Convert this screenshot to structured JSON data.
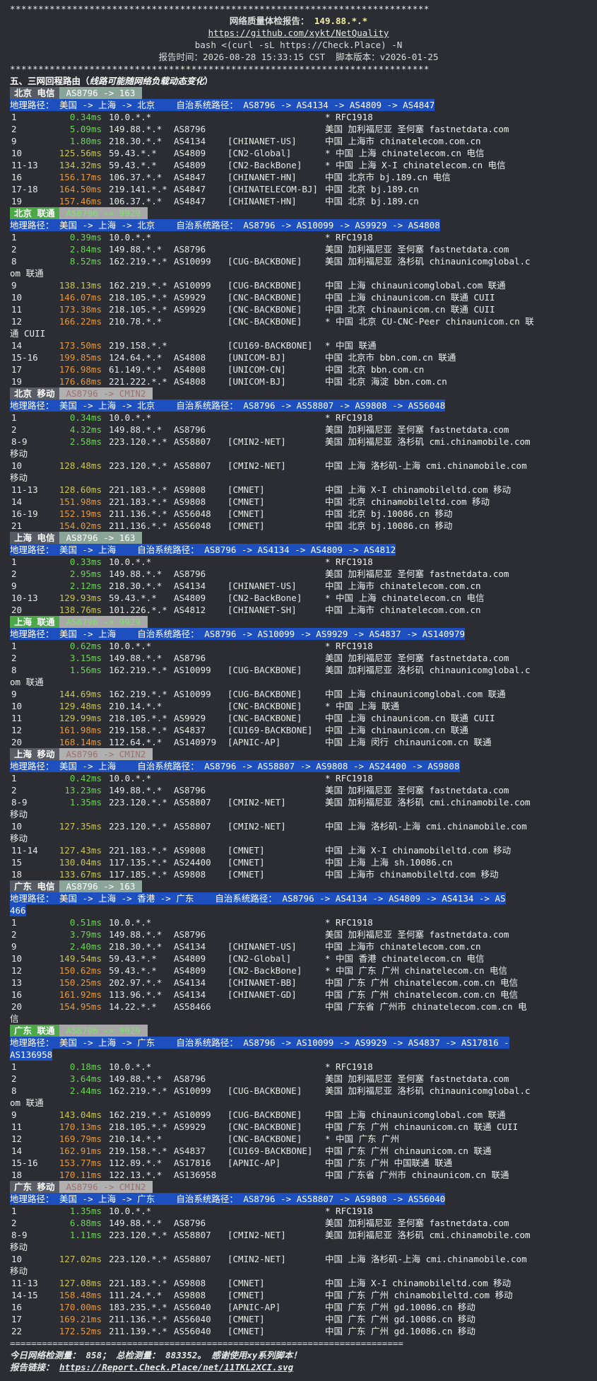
{
  "stars": "**************************************************************************",
  "header": {
    "title": "网络质量体检报告：",
    "ip": "149.88.*.*",
    "url": "https://github.com/xykt/NetQuality",
    "cmd": "bash <(curl -sL https://Check.Place) -N",
    "time_label": "报告时间：",
    "time": "2026-08-28 15:33:15 CST",
    "ver_label": "脚本版本：",
    "ver": "v2026-01-25"
  },
  "section": {
    "title": "五、三网回程路由（",
    "subtitle": "线路可能随网络负载动态变化",
    "close": "）"
  },
  "blocks": [
    {
      "city": "北京 电信",
      "city_class": "city-ct",
      "asg": "AS8796 -> 163",
      "asg_class": "g",
      "route": "地理路径： 美国 -> 上海 -> 北京    自治系统路径： AS8796 -> AS4134 -> AS4809 -> AS4847",
      "hops": [
        {
          "n": "1",
          "ms": "0.34ms",
          "c": "g",
          "ip": "10.0.*.*",
          "as": "",
          "tag": "",
          "geo": "* RFC1918"
        },
        {
          "n": "2",
          "ms": "5.09ms",
          "c": "g",
          "ip": "149.88.*.*",
          "as": "AS8796",
          "tag": "",
          "geo": "美国 加利福尼亚 圣何塞 fastnetdata.com"
        },
        {
          "n": "9",
          "ms": "1.80ms",
          "c": "g",
          "ip": "218.30.*.*",
          "as": "AS4134",
          "tag": "[CHINANET-US]",
          "geo": "中国 上海市 chinatelecom.com.cn"
        },
        {
          "n": "10",
          "ms": "125.56ms",
          "c": "y",
          "ip": "59.43.*.*",
          "as": "AS4809",
          "tag": "[CN2-Global]",
          "geo": "* 中国 上海 chinatelecom.cn 电信"
        },
        {
          "n": "11-13",
          "ms": "134.32ms",
          "c": "y",
          "ip": "59.43.*.*",
          "as": "AS4809",
          "tag": "[CN2-BackBone]",
          "geo": "* 中国 上海 X-I chinatelecom.cn 电信"
        },
        {
          "n": "16",
          "ms": "156.17ms",
          "c": "o",
          "ip": "106.37.*.*",
          "as": "AS4847",
          "tag": "[CHINANET-HN]",
          "geo": "中国 北京市 bj.189.cn 电信"
        },
        {
          "n": "17-18",
          "ms": "164.50ms",
          "c": "o",
          "ip": "219.141.*.*",
          "as": "AS4847",
          "tag": "[CHINATELECOM-BJ]",
          "geo": "中国 北京 bj.189.cn"
        },
        {
          "n": "19",
          "ms": "157.46ms",
          "c": "o",
          "ip": "106.37.*.*",
          "as": "AS4847",
          "tag": "[CHINANET-HN]",
          "geo": "中国 北京 bj.189.cn"
        }
      ]
    },
    {
      "city": "北京 联通",
      "city_class": "city-cu",
      "asg": "AS8796 -> 9929",
      "asg_class": "y",
      "route": "地理路径： 美国 -> 上海 -> 北京    自治系统路径： AS8796 -> AS10099 -> AS9929 -> AS4808",
      "hops": [
        {
          "n": "1",
          "ms": "0.39ms",
          "c": "g",
          "ip": "10.0.*.*",
          "as": "",
          "tag": "",
          "geo": "* RFC1918"
        },
        {
          "n": "2",
          "ms": "2.84ms",
          "c": "g",
          "ip": "149.88.*.*",
          "as": "AS8796",
          "tag": "",
          "geo": "美国 加利福尼亚 圣何塞 fastnetdata.com"
        },
        {
          "n": "8",
          "ms": "8.52ms",
          "c": "g",
          "ip": "162.219.*.*",
          "as": "AS10099",
          "tag": "[CUG-BACKBONE]",
          "geo": "美国 加利福尼亚 洛杉矶 chinaunicomglobal.c",
          "cont": "om 联通"
        },
        {
          "n": "9",
          "ms": "138.13ms",
          "c": "y",
          "ip": "162.219.*.*",
          "as": "AS10099",
          "tag": "[CUG-BACKBONE]",
          "geo": "中国 上海 chinaunicomglobal.com 联通"
        },
        {
          "n": "10",
          "ms": "146.07ms",
          "c": "o",
          "ip": "218.105.*.*",
          "as": "AS9929",
          "tag": "[CNC-BACKBONE]",
          "geo": "中国 上海 chinaunicom.cn 联通 CUII"
        },
        {
          "n": "11",
          "ms": "173.38ms",
          "c": "o",
          "ip": "218.105.*.*",
          "as": "AS9929",
          "tag": "[CNC-BACKBONE]",
          "geo": "中国 北京 chinaunicom.cn 联通 CUII"
        },
        {
          "n": "12",
          "ms": "166.22ms",
          "c": "o",
          "ip": "210.78.*.*",
          "as": "",
          "tag": "[CNC-BACKBONE]",
          "geo": "* 中国 北京 CU-CNC-Peer chinaunicom.cn 联",
          "cont": "通 CUII"
        },
        {
          "n": "14",
          "ms": "173.50ms",
          "c": "o",
          "ip": "219.158.*.*",
          "as": "",
          "tag": "[CU169-BACKBONE]",
          "geo": "* 中国 联通"
        },
        {
          "n": "15-16",
          "ms": "199.85ms",
          "c": "o",
          "ip": "124.64.*.*",
          "as": "AS4808",
          "tag": "[UNICOM-BJ]",
          "geo": "中国 北京市 bbn.com.cn 联通"
        },
        {
          "n": "17",
          "ms": "176.98ms",
          "c": "o",
          "ip": "61.149.*.*",
          "as": "AS4808",
          "tag": "[UNICOM-CN]",
          "geo": "中国 北京 bbn.com.cn"
        },
        {
          "n": "19",
          "ms": "176.68ms",
          "c": "o",
          "ip": "221.222.*.*",
          "as": "AS4808",
          "tag": "[UNICOM-BJ]",
          "geo": "中国 北京 海淀 bbn.com.cn"
        }
      ]
    },
    {
      "city": "北京 移动",
      "city_class": "city-cm",
      "asg": "AS8796 -> CMIN2",
      "asg_class": "c",
      "route": "地理路径： 美国 -> 上海 -> 北京    自治系统路径： AS8796 -> AS58807 -> AS9808 -> AS56048",
      "hops": [
        {
          "n": "1",
          "ms": "0.34ms",
          "c": "g",
          "ip": "10.0.*.*",
          "as": "",
          "tag": "",
          "geo": "* RFC1918"
        },
        {
          "n": "2",
          "ms": "4.32ms",
          "c": "g",
          "ip": "149.88.*.*",
          "as": "AS8796",
          "tag": "",
          "geo": "美国 加利福尼亚 圣何塞 fastnetdata.com"
        },
        {
          "n": "8-9",
          "ms": "2.58ms",
          "c": "g",
          "ip": "223.120.*.*",
          "as": "AS58807",
          "tag": "[CMIN2-NET]",
          "geo": "美国 加利福尼亚 洛杉矶 cmi.chinamobile.com",
          "cont": "移动"
        },
        {
          "n": "10",
          "ms": "128.48ms",
          "c": "y",
          "ip": "223.120.*.*",
          "as": "AS58807",
          "tag": "[CMIN2-NET]",
          "geo": "中国 上海 洛杉矶-上海 cmi.chinamobile.com",
          "cont": "移动"
        },
        {
          "n": "11-13",
          "ms": "128.60ms",
          "c": "y",
          "ip": "221.183.*.*",
          "as": "AS9808",
          "tag": "[CMNET]",
          "geo": "中国 上海 X-I chinamobileltd.com 移动"
        },
        {
          "n": "14",
          "ms": "151.98ms",
          "c": "o",
          "ip": "221.183.*.*",
          "as": "AS9808",
          "tag": "[CMNET]",
          "geo": "中国 北京 chinamobileltd.com 移动"
        },
        {
          "n": "16-19",
          "ms": "152.19ms",
          "c": "o",
          "ip": "211.136.*.*",
          "as": "AS56048",
          "tag": "[CMNET]",
          "geo": "中国 北京 bj.10086.cn 移动"
        },
        {
          "n": "21",
          "ms": "154.02ms",
          "c": "o",
          "ip": "211.136.*.*",
          "as": "AS56048",
          "tag": "[CMNET]",
          "geo": "中国 北京 bj.10086.cn 移动"
        }
      ]
    },
    {
      "city": "上海 电信",
      "city_class": "city-ct",
      "asg": "AS8796 -> 163",
      "asg_class": "g",
      "route": "地理路径： 美国 -> 上海    自治系统路径： AS8796 -> AS4134 -> AS4809 -> AS4812",
      "hops": [
        {
          "n": "1",
          "ms": "0.33ms",
          "c": "g",
          "ip": "10.0.*.*",
          "as": "",
          "tag": "",
          "geo": "* RFC1918"
        },
        {
          "n": "2",
          "ms": "2.95ms",
          "c": "g",
          "ip": "149.88.*.*",
          "as": "AS8796",
          "tag": "",
          "geo": "美国 加利福尼亚 圣何塞 fastnetdata.com"
        },
        {
          "n": "9",
          "ms": "2.12ms",
          "c": "g",
          "ip": "218.30.*.*",
          "as": "AS4134",
          "tag": "[CHINANET-US]",
          "geo": "中国 上海市 chinatelecom.com.cn"
        },
        {
          "n": "10-13",
          "ms": "129.93ms",
          "c": "y",
          "ip": "59.43.*.*",
          "as": "AS4809",
          "tag": "[CN2-BackBone]",
          "geo": "* 中国 上海 chinatelecom.cn 电信"
        },
        {
          "n": "20",
          "ms": "138.76ms",
          "c": "y",
          "ip": "101.226.*.*",
          "as": "AS4812",
          "tag": "[CHINANET-SH]",
          "geo": "中国 上海市 chinatelecom.com.cn"
        }
      ]
    },
    {
      "city": "上海 联通",
      "city_class": "city-cu",
      "asg": "AS8796 -> 9929",
      "asg_class": "y",
      "route": "地理路径： 美国 -> 上海    自治系统路径： AS8796 -> AS10099 -> AS9929 -> AS4837 -> AS140979",
      "hops": [
        {
          "n": "1",
          "ms": "0.62ms",
          "c": "g",
          "ip": "10.0.*.*",
          "as": "",
          "tag": "",
          "geo": "* RFC1918"
        },
        {
          "n": "2",
          "ms": "3.15ms",
          "c": "g",
          "ip": "149.88.*.*",
          "as": "AS8796",
          "tag": "",
          "geo": "美国 加利福尼亚 圣何塞 fastnetdata.com"
        },
        {
          "n": "8",
          "ms": "1.56ms",
          "c": "g",
          "ip": "162.219.*.*",
          "as": "AS10099",
          "tag": "[CUG-BACKBONE]",
          "geo": "美国 加利福尼亚 洛杉矶 chinaunicomglobal.c",
          "cont": "om 联通"
        },
        {
          "n": "9",
          "ms": "144.69ms",
          "c": "y",
          "ip": "162.219.*.*",
          "as": "AS10099",
          "tag": "[CUG-BACKBONE]",
          "geo": "中国 上海 chinaunicomglobal.com 联通"
        },
        {
          "n": "10",
          "ms": "129.48ms",
          "c": "y",
          "ip": "210.14.*.*",
          "as": "",
          "tag": "[CNC-BACKBONE]",
          "geo": "* 中国 上海 联通"
        },
        {
          "n": "11",
          "ms": "129.99ms",
          "c": "y",
          "ip": "218.105.*.*",
          "as": "AS9929",
          "tag": "[CNC-BACKBONE]",
          "geo": "中国 上海 chinaunicom.cn 联通 CUII"
        },
        {
          "n": "12",
          "ms": "161.98ms",
          "c": "o",
          "ip": "219.158.*.*",
          "as": "AS4837",
          "tag": "[CU169-BACKBONE]",
          "geo": "中国 上海 chinaunicom.cn 联通"
        },
        {
          "n": "20",
          "ms": "168.14ms",
          "c": "o",
          "ip": "112.64.*.*",
          "as": "AS140979",
          "tag": "[APNIC-AP]",
          "geo": "中国 上海 闵行 chinaunicom.cn 联通"
        }
      ]
    },
    {
      "city": "上海 移动",
      "city_class": "city-cm",
      "asg": "AS8796 -> CMIN2",
      "asg_class": "c",
      "route": "地理路径： 美国 -> 上海    自治系统路径： AS8796 -> AS58807 -> AS9808 -> AS24400 -> AS9808",
      "hops": [
        {
          "n": "1",
          "ms": "0.42ms",
          "c": "g",
          "ip": "10.0.*.*",
          "as": "",
          "tag": "",
          "geo": "* RFC1918"
        },
        {
          "n": "2",
          "ms": "13.23ms",
          "c": "g",
          "ip": "149.88.*.*",
          "as": "AS8796",
          "tag": "",
          "geo": "美国 加利福尼亚 圣何塞 fastnetdata.com"
        },
        {
          "n": "8-9",
          "ms": "1.35ms",
          "c": "g",
          "ip": "223.120.*.*",
          "as": "AS58807",
          "tag": "[CMIN2-NET]",
          "geo": "美国 加利福尼亚 洛杉矶 cmi.chinamobile.com",
          "cont": "移动"
        },
        {
          "n": "10",
          "ms": "127.35ms",
          "c": "y",
          "ip": "223.120.*.*",
          "as": "AS58807",
          "tag": "[CMIN2-NET]",
          "geo": "中国 上海 洛杉矶-上海 cmi.chinamobile.com",
          "cont": "移动"
        },
        {
          "n": "11-14",
          "ms": "127.43ms",
          "c": "y",
          "ip": "221.183.*.*",
          "as": "AS9808",
          "tag": "[CMNET]",
          "geo": "中国 上海 X-I chinamobileltd.com 移动"
        },
        {
          "n": "15",
          "ms": "130.04ms",
          "c": "y",
          "ip": "117.135.*.*",
          "as": "AS24400",
          "tag": "[CMNET]",
          "geo": "中国 上海 上海 sh.10086.cn"
        },
        {
          "n": "18",
          "ms": "133.67ms",
          "c": "y",
          "ip": "117.185.*.*",
          "as": "AS9808",
          "tag": "[CMNET]",
          "geo": "中国 上海市 chinamobileltd.com 移动"
        }
      ]
    },
    {
      "city": "广东 电信",
      "city_class": "city-ct",
      "asg": "AS8796 -> 163",
      "asg_class": "g",
      "route": "地理路径： 美国 -> 上海 -> 香港 -> 广东    自治系统路径： AS8796 -> AS4134 -> AS4809 -> AS4134 -> AS",
      "route_cont": "466",
      "hops": [
        {
          "n": "1",
          "ms": "0.51ms",
          "c": "g",
          "ip": "10.0.*.*",
          "as": "",
          "tag": "",
          "geo": "* RFC1918"
        },
        {
          "n": "2",
          "ms": "3.79ms",
          "c": "g",
          "ip": "149.88.*.*",
          "as": "AS8796",
          "tag": "",
          "geo": "美国 加利福尼亚 圣何塞 fastnetdata.com"
        },
        {
          "n": "9",
          "ms": "2.40ms",
          "c": "g",
          "ip": "218.30.*.*",
          "as": "AS4134",
          "tag": "[CHINANET-US]",
          "geo": "中国 上海市 chinatelecom.com.cn"
        },
        {
          "n": "10",
          "ms": "149.54ms",
          "c": "y",
          "ip": "59.43.*.*",
          "as": "AS4809",
          "tag": "[CN2-Global]",
          "geo": "* 中国 香港 chinatelecom.cn 电信"
        },
        {
          "n": "12",
          "ms": "150.62ms",
          "c": "o",
          "ip": "59.43.*.*",
          "as": "AS4809",
          "tag": "[CN2-BackBone]",
          "geo": "* 中国 广东 广州 chinatelecom.cn 电信"
        },
        {
          "n": "13",
          "ms": "150.25ms",
          "c": "o",
          "ip": "202.97.*.*",
          "as": "AS4134",
          "tag": "[CHINANET-BB]",
          "geo": "中国 广东 广州 chinatelecom.com.cn 电信"
        },
        {
          "n": "16",
          "ms": "161.92ms",
          "c": "o",
          "ip": "113.96.*.*",
          "as": "AS4134",
          "tag": "[CHINANET-GD]",
          "geo": "中国 广东 广州 chinatelecom.com.cn 电信"
        },
        {
          "n": "20",
          "ms": "154.95ms",
          "c": "o",
          "ip": "14.22.*.*",
          "as": "AS58466",
          "tag": "",
          "geo": "中国 广东省 广州市 chinatelecom.com.cn 电",
          "cont": "信"
        }
      ]
    },
    {
      "city": "广东 联通",
      "city_class": "city-cu",
      "asg": "AS8796 -> 9929",
      "asg_class": "y",
      "route": "地理路径： 美国 -> 上海 -> 广东    自治系统路径： AS8796 -> AS10099 -> AS9929 -> AS4837 -> AS17816 -",
      "route_cont": "AS136958",
      "hops": [
        {
          "n": "1",
          "ms": "0.18ms",
          "c": "g",
          "ip": "10.0.*.*",
          "as": "",
          "tag": "",
          "geo": "* RFC1918"
        },
        {
          "n": "2",
          "ms": "3.64ms",
          "c": "g",
          "ip": "149.88.*.*",
          "as": "AS8796",
          "tag": "",
          "geo": "美国 加利福尼亚 圣何塞 fastnetdata.com"
        },
        {
          "n": "8",
          "ms": "2.44ms",
          "c": "g",
          "ip": "162.219.*.*",
          "as": "AS10099",
          "tag": "[CUG-BACKBONE]",
          "geo": "美国 加利福尼亚 洛杉矶 chinaunicomglobal.c",
          "cont": "om 联通"
        },
        {
          "n": "9",
          "ms": "143.04ms",
          "c": "y",
          "ip": "162.219.*.*",
          "as": "AS10099",
          "tag": "[CUG-BACKBONE]",
          "geo": "中国 上海 chinaunicomglobal.com 联通"
        },
        {
          "n": "11",
          "ms": "170.13ms",
          "c": "o",
          "ip": "218.105.*.*",
          "as": "AS9929",
          "tag": "[CNC-BACKBONE]",
          "geo": "中国 广东 广州 chinaunicom.cn 联通 CUII"
        },
        {
          "n": "12",
          "ms": "169.79ms",
          "c": "o",
          "ip": "210.14.*.*",
          "as": "",
          "tag": "[CNC-BACKBONE]",
          "geo": "* 中国 广东 广州"
        },
        {
          "n": "14",
          "ms": "162.91ms",
          "c": "o",
          "ip": "219.158.*.*",
          "as": "AS4837",
          "tag": "[CU169-BACKBONE]",
          "geo": "中国 广东 广州 chinaunicom.cn 联通"
        },
        {
          "n": "15-16",
          "ms": "153.77ms",
          "c": "o",
          "ip": "112.89.*.*",
          "as": "AS17816",
          "tag": "[APNIC-AP]",
          "geo": "中国 广东 广州 中国联通 联通"
        },
        {
          "n": "18",
          "ms": "170.11ms",
          "c": "o",
          "ip": "122.13.*.*",
          "as": "AS136958",
          "tag": "",
          "geo": "中国 广东省 广州市 chinaunicom.cn 联通"
        }
      ]
    },
    {
      "city": "广东 移动",
      "city_class": "city-cm",
      "asg": "AS8796 -> CMIN2",
      "asg_class": "c",
      "route": "地理路径： 美国 -> 上海 -> 广东    自治系统路径： AS8796 -> AS58807 -> AS9808 -> AS56040",
      "hops": [
        {
          "n": "1",
          "ms": "1.35ms",
          "c": "g",
          "ip": "10.0.*.*",
          "as": "",
          "tag": "",
          "geo": "* RFC1918"
        },
        {
          "n": "2",
          "ms": "6.88ms",
          "c": "g",
          "ip": "149.88.*.*",
          "as": "AS8796",
          "tag": "",
          "geo": "美国 加利福尼亚 圣何塞 fastnetdata.com"
        },
        {
          "n": "8-9",
          "ms": "1.11ms",
          "c": "g",
          "ip": "223.120.*.*",
          "as": "AS58807",
          "tag": "[CMIN2-NET]",
          "geo": "美国 加利福尼亚 洛杉矶 cmi.chinamobile.com",
          "cont": "移动"
        },
        {
          "n": "10",
          "ms": "127.02ms",
          "c": "y",
          "ip": "223.120.*.*",
          "as": "AS58807",
          "tag": "[CMIN2-NET]",
          "geo": "中国 上海 洛杉矶-上海 cmi.chinamobile.com",
          "cont": "移动"
        },
        {
          "n": "11-13",
          "ms": "127.08ms",
          "c": "y",
          "ip": "221.183.*.*",
          "as": "AS9808",
          "tag": "[CMNET]",
          "geo": "中国 上海 X-I chinamobileltd.com 移动"
        },
        {
          "n": "14-15",
          "ms": "158.48ms",
          "c": "o",
          "ip": "111.24.*.*",
          "as": "AS9808",
          "tag": "[CMNET]",
          "geo": "中国 广东 广州 chinamobileltd.com 移动"
        },
        {
          "n": "16",
          "ms": "170.00ms",
          "c": "o",
          "ip": "183.235.*.*",
          "as": "AS56040",
          "tag": "[APNIC-AP]",
          "geo": "中国 广东 广州 gd.10086.cn 移动"
        },
        {
          "n": "17",
          "ms": "169.21ms",
          "c": "o",
          "ip": "211.136.*.*",
          "as": "AS56040",
          "tag": "[CMNET]",
          "geo": "中国 广东 广州 gd.10086.cn 移动"
        },
        {
          "n": "22",
          "ms": "172.52ms",
          "c": "o",
          "ip": "211.139.*.*",
          "as": "AS56040",
          "tag": "[CMNET]",
          "geo": "中国 广东 广州 gd.10086.cn 移动"
        }
      ]
    }
  ],
  "footer": {
    "eq": "==========================================================================",
    "stats": "今日网络检测量： 858； 总检测量： 883352。 感谢使用xy系列脚本！",
    "link_label": "报告链接：",
    "link": "https://Report.Check.Place/net/11TKL2XCI.svg"
  }
}
